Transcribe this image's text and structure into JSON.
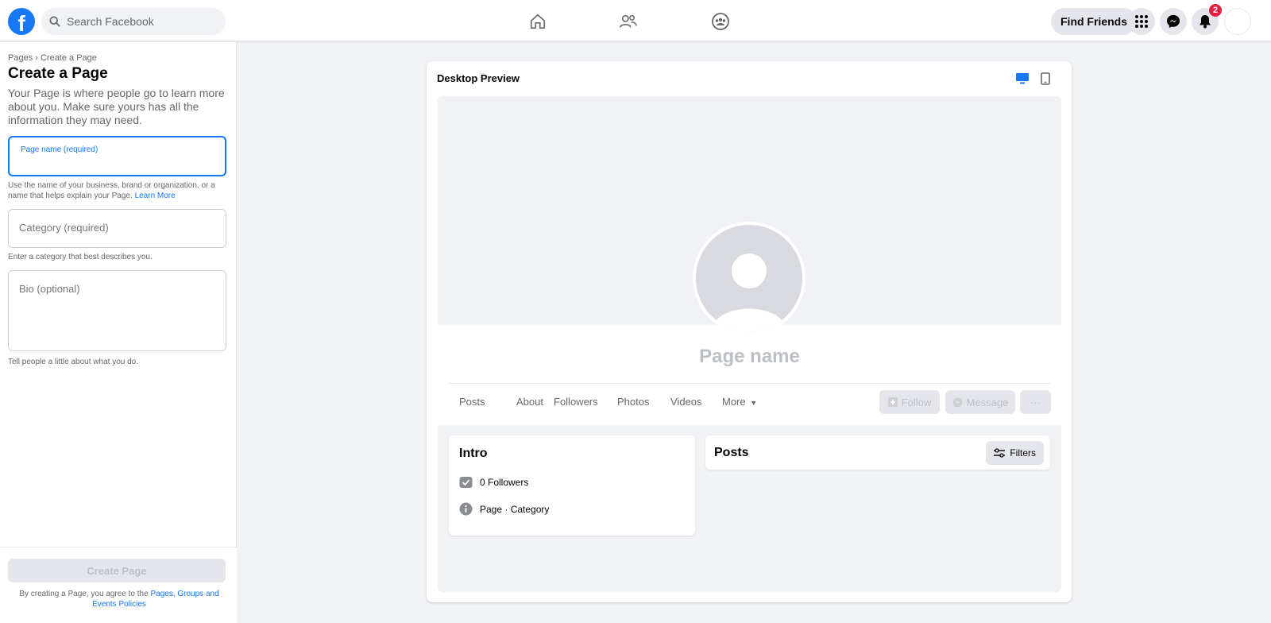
{
  "topbar": {
    "search_placeholder": "Search Facebook",
    "find_friends_label": "Find Friends",
    "notification_count": "2"
  },
  "left_panel": {
    "breadcrumb": "Pages › Create a Page",
    "title": "Create a Page",
    "description": "Your Page is where people go to learn more about you. Make sure yours has all the information they may need.",
    "page_name_label": "Page name (required)",
    "page_name_value": "",
    "page_name_helper": "Use the name of your business, brand or organization, or a name that helps explain your Page.",
    "learn_more": "Learn More",
    "category_placeholder": "Category (required)",
    "category_helper": "Enter a category that best describes you.",
    "bio_placeholder": "Bio (optional)",
    "bio_helper": "Tell people a little about what you do.",
    "create_button": "Create Page",
    "terms_prefix": "By creating a Page, you agree to the",
    "terms_link": "Pages, Groups and Events Policies"
  },
  "preview": {
    "title": "Desktop Preview",
    "page_name": "Page name",
    "tabs": [
      "Posts",
      "About",
      "Followers",
      "Photos",
      "Videos",
      "More"
    ],
    "follow_label": "Follow",
    "message_label": "Message",
    "more_options": "···",
    "intro_title": "Intro",
    "followers_text": "0 Followers",
    "page_category_text": "Page · Category",
    "posts_title": "Posts",
    "filters_label": "Filters"
  },
  "colors": {
    "brand": "#1877f2",
    "badge": "#e41e3f",
    "background": "#f0f2f5"
  },
  "icons": {
    "logo": "facebook-logo",
    "home": "home-icon",
    "friends": "friends-icon",
    "groups": "groups-icon",
    "menu": "grid-menu-icon",
    "messenger": "messenger-icon",
    "notifications": "bell-icon"
  }
}
